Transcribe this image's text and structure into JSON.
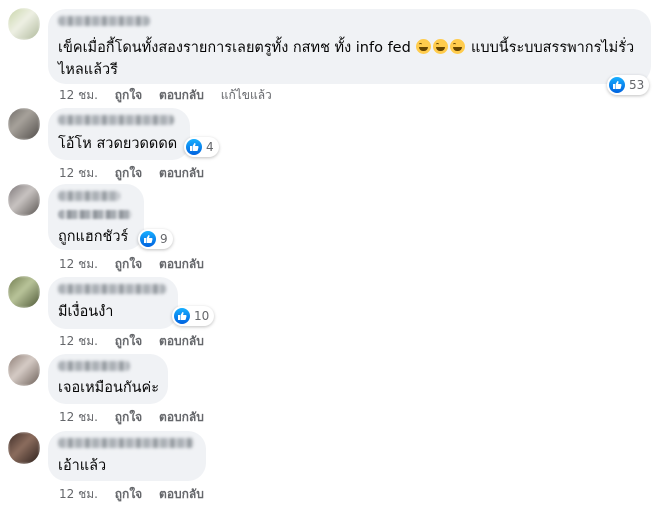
{
  "comments": [
    {
      "text_lines": [
        "เข็คเมื่อกี้โดนทั้งสองรายการเลยตรูทั้ง กสทช ทั้ง info fed",
        "ไหลแล้วรี"
      ],
      "trailing_text": "แบบนี้ระบบสรรพากรไม่รั่ว",
      "emoji_name": "grinning-face-icon",
      "time": "12 ชม.",
      "like": "ถูกใจ",
      "reply": "ตอบกลับ",
      "edited": "แก้ไขแล้ว",
      "reaction_count": "53"
    },
    {
      "text_lines": [
        "โอ้โห สวดยวดดดด"
      ],
      "time": "12 ชม.",
      "like": "ถูกใจ",
      "reply": "ตอบกลับ",
      "reaction_count": "4"
    },
    {
      "text_lines": [
        "ถูกแฮกชัวร์"
      ],
      "time": "12 ชม.",
      "like": "ถูกใจ",
      "reply": "ตอบกลับ",
      "reaction_count": "9"
    },
    {
      "text_lines": [
        "มีเงื่อนงำ"
      ],
      "time": "12 ชม.",
      "like": "ถูกใจ",
      "reply": "ตอบกลับ",
      "reaction_count": "10"
    },
    {
      "text_lines": [
        "เจอเหมือนกันค่ะ"
      ],
      "time": "12 ชม.",
      "like": "ถูกใจ",
      "reply": "ตอบกลับ"
    },
    {
      "text_lines": [
        "เอ้าแล้ว"
      ],
      "time": "12 ชม.",
      "like": "ถูกใจ",
      "reply": "ตอบกลับ"
    }
  ],
  "colors": {
    "bubble": "#f0f2f5",
    "meta": "#65676b",
    "like_blue": "#1877f2"
  }
}
